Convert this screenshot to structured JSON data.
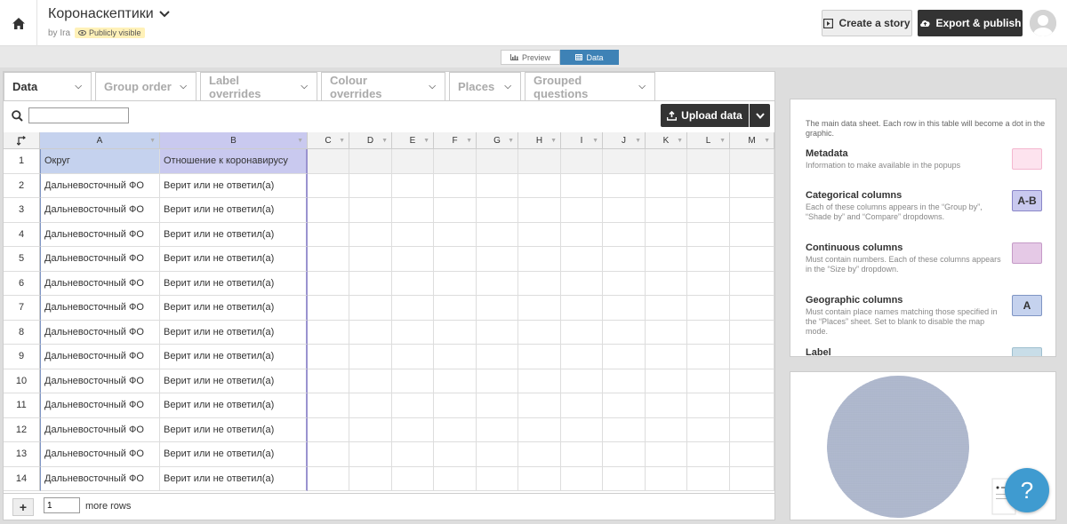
{
  "header": {
    "title": "Коронаскептики",
    "byline": "by Ira",
    "visibility": "Publicly visible",
    "create_story": "Create a story",
    "export_publish": "Export & publish"
  },
  "view_toggle": {
    "preview": "Preview",
    "data": "Data"
  },
  "tabs": [
    {
      "label": "Data"
    },
    {
      "label": "Group order"
    },
    {
      "label": "Label overrides"
    },
    {
      "label": "Colour overrides"
    },
    {
      "label": "Places"
    },
    {
      "label": "Grouped questions"
    }
  ],
  "toolbar": {
    "search_value": "",
    "upload_label": "Upload data"
  },
  "columns": [
    "A",
    "B",
    "C",
    "D",
    "E",
    "F",
    "G",
    "H",
    "I",
    "J",
    "K",
    "L",
    "M"
  ],
  "header_row": {
    "num": "1",
    "a": "Округ",
    "b": "Отношение к коронавирусу"
  },
  "rows": [
    {
      "num": "2",
      "a": "Дальневосточный ФО",
      "b": "Верит или не ответил(а)"
    },
    {
      "num": "3",
      "a": "Дальневосточный ФО",
      "b": "Верит или не ответил(а)"
    },
    {
      "num": "4",
      "a": "Дальневосточный ФО",
      "b": "Верит или не ответил(а)"
    },
    {
      "num": "5",
      "a": "Дальневосточный ФО",
      "b": "Верит или не ответил(а)"
    },
    {
      "num": "6",
      "a": "Дальневосточный ФО",
      "b": "Верит или не ответил(а)"
    },
    {
      "num": "7",
      "a": "Дальневосточный ФО",
      "b": "Верит или не ответил(а)"
    },
    {
      "num": "8",
      "a": "Дальневосточный ФО",
      "b": "Верит или не ответил(а)"
    },
    {
      "num": "9",
      "a": "Дальневосточный ФО",
      "b": "Верит или не ответил(а)"
    },
    {
      "num": "10",
      "a": "Дальневосточный ФО",
      "b": "Верит или не ответил(а)"
    },
    {
      "num": "11",
      "a": "Дальневосточный ФО",
      "b": "Верит или не ответил(а)"
    },
    {
      "num": "12",
      "a": "Дальневосточный ФО",
      "b": "Верит или не ответил(а)"
    },
    {
      "num": "13",
      "a": "Дальневосточный ФО",
      "b": "Верит или не ответил(а)"
    },
    {
      "num": "14",
      "a": "Дальневосточный ФО",
      "b": "Верит или не ответил(а)"
    }
  ],
  "footer": {
    "rows_value": "1",
    "more_rows": "more rows"
  },
  "info": {
    "intro": "The main data sheet. Each row in this table will become a dot in the graphic.",
    "legend": [
      {
        "title": "Metadata",
        "desc": "Information to make available in the popups",
        "swatch_text": "",
        "color": "#fde3ee",
        "border": "#f4b7cf"
      },
      {
        "title": "Categorical columns",
        "desc": "Each of these columns appears in the “Group by”, “Shade by” and “Compare” dropdowns.",
        "swatch_text": "A-B",
        "color": "#c9c9ef",
        "border": "#8a86c8"
      },
      {
        "title": "Continuous columns",
        "desc": "Must contain numbers. Each of these columns appears in the “Size by” dropdown.",
        "swatch_text": "",
        "color": "#e5c9e6",
        "border": "#c59ac7"
      },
      {
        "title": "Geographic columns",
        "desc": "Must contain place names matching those specified in the “Places” sheet. Set to blank to disable the map mode.",
        "swatch_text": "A",
        "color": "#c5d2ee",
        "border": "#7f95c4"
      },
      {
        "title": "Label",
        "desc": "",
        "swatch_text": "",
        "color": "#c8dde8",
        "border": "#9ebfcf"
      }
    ]
  },
  "colors": {
    "accent": "#3e82b6",
    "col_a": "#c5d2ee",
    "col_b": "#c9c9ef",
    "help": "#3f9bd0"
  }
}
